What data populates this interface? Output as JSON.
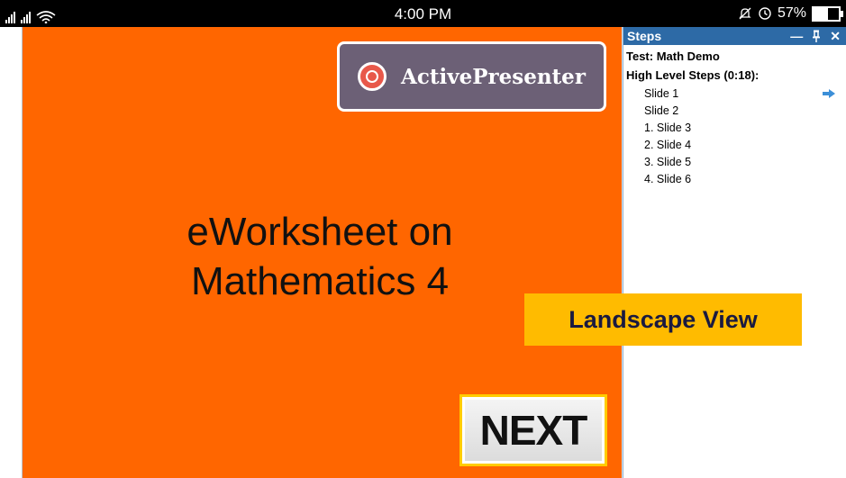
{
  "status_bar": {
    "time": "4:00 PM",
    "battery": "57%",
    "battery_level": 0.57
  },
  "slide": {
    "logo_text": "ActivePresenter",
    "title_line1": "eWorksheet on",
    "title_line2": "Mathematics 4",
    "next_label": "NEXT",
    "background": "#ff6600"
  },
  "steps_panel": {
    "title": "Steps",
    "test_label": "Test: Math Demo",
    "high_level_label": "High Level Steps (0:18):",
    "items": [
      "Slide 1",
      "Slide 2",
      "1. Slide 3",
      "2. Slide 4",
      "3. Slide 5",
      "4. Slide 6"
    ],
    "current_index": 0,
    "header_color": "#2d6aa6"
  },
  "overlay_label": "Landscape View",
  "icons": [
    "signal-icon",
    "wifi-icon",
    "alarm-off-icon",
    "clock-icon",
    "battery-icon",
    "minimize-icon",
    "pin-icon",
    "close-icon",
    "arrow-right-icon",
    "activepresenter-logo-icon"
  ]
}
